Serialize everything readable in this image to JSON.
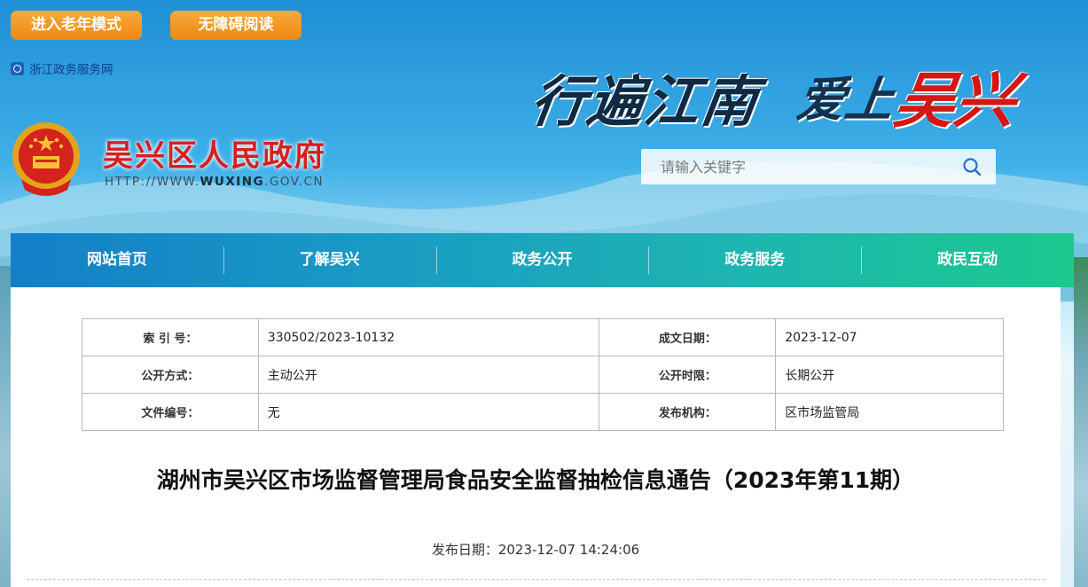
{
  "header": {
    "elder_mode_label": "进入老年模式",
    "accessible_label": "无障碍阅读",
    "portal_link": "浙江政务服务网",
    "site_title": "吴兴区人民政府",
    "site_url_prefix": "HTTP://WWW.",
    "site_url_domain": "WUXING",
    "site_url_suffix": ".GOV.CN",
    "slogan_part1": "行遍江南",
    "slogan_part2": "爱上",
    "slogan_part3": "吴兴",
    "search_placeholder": "请输入关键字"
  },
  "nav": {
    "items": [
      "网站首页",
      "了解吴兴",
      "政务公开",
      "政务服务",
      "政民互动"
    ]
  },
  "meta_table": {
    "rows": [
      {
        "k1": "索 引 号：",
        "v1": "330502/2023-10132",
        "k2": "成文日期：",
        "v2": "2023-12-07"
      },
      {
        "k1": "公开方式：",
        "v1": "主动公开",
        "k2": "公开时限：",
        "v2": "长期公开"
      },
      {
        "k1": "文件编号：",
        "v1": "无",
        "k2": "发布机构：",
        "v2": "区市场监管局"
      }
    ]
  },
  "article": {
    "title": "湖州市吴兴区市场监督管理局食品安全监督抽检信息通告（2023年第11期）",
    "publish_label": "发布日期：",
    "publish_time": "2023-12-07 14:24:06"
  },
  "colors": {
    "button_orange": "#ee8a10",
    "title_red": "#d81e1e",
    "nav_start": "#137fc8",
    "nav_end": "#1cc98e"
  }
}
